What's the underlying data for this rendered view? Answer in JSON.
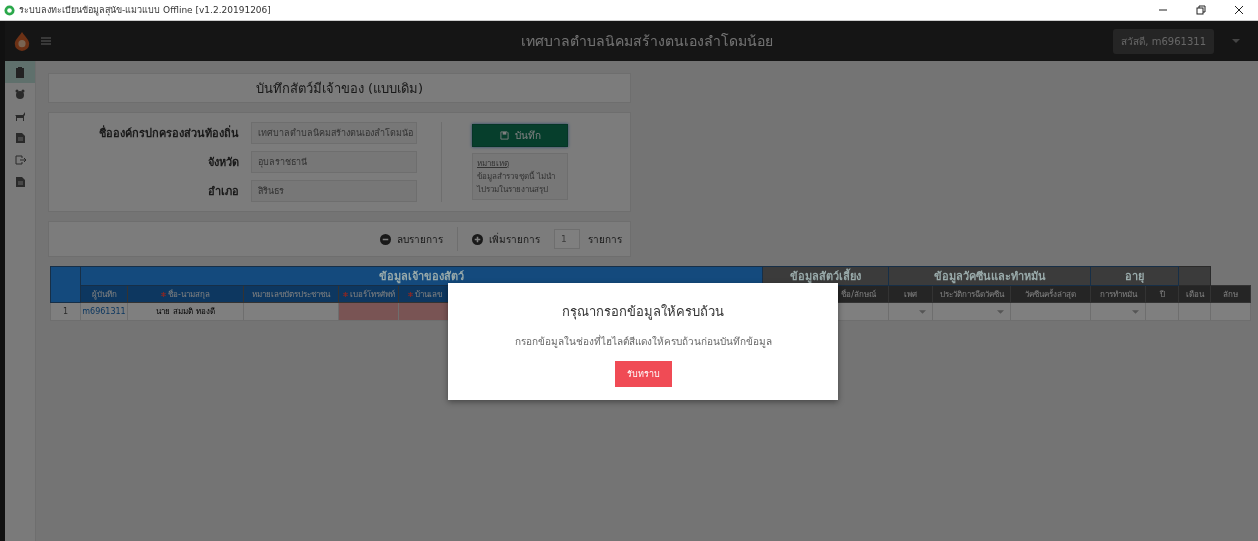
{
  "title_bar": {
    "title": "ระบบลงทะเบียนข้อมูลสุนัข-แมวแบบ Offline [v1.2.20191206]"
  },
  "header": {
    "title": "เทศบาลตำบลนิคมสร้างตนเองลำโดมน้อย",
    "user": "สวัสดี, m6961311"
  },
  "sidebar": {
    "items": [
      {
        "selected": true
      },
      {
        "selected": false
      },
      {
        "selected": false
      },
      {
        "selected": false
      },
      {
        "selected": false
      },
      {
        "selected": false
      }
    ]
  },
  "page_title": "บันทึกสัตว์มีเจ้าของ (แบบเดิม)",
  "form": {
    "fields": [
      {
        "label": "ชื่อองค์กรปกครองส่วนท้องถิ่น",
        "value": "เทศบาลตำบลนิคมสร้างตนเองลำโดมน้อ"
      },
      {
        "label": "จังหวัด",
        "value": "อุบลราชธานี"
      },
      {
        "label": "อำเภอ",
        "value": "สิรินธร"
      }
    ],
    "save_button": "บันทึก",
    "note": {
      "heading": "หมายเหตุ",
      "text": "ข้อมูลสำรวจชุดนี้ ไม่นำไปรวมในรายงานสรุป"
    }
  },
  "toolbar": {
    "remove": "ลบรายการ",
    "add": "เพิ่มรายการ",
    "count": "1",
    "unit": "รายการ"
  },
  "table": {
    "groups": [
      {
        "label": "ข้อมูลเจ้าของสัตว์",
        "color": "#144a7d"
      },
      {
        "label": "ข้อมูลสัตว์เลี้ยง",
        "color": "#3b3b3b"
      },
      {
        "label": "ข้อมูลวัคซีนและทำหมัน",
        "color": "#3b3b3b"
      },
      {
        "label": "อายุ",
        "color": "#3b3b3b"
      }
    ],
    "columns": [
      {
        "label": "ผู้บันทึก",
        "required": false
      },
      {
        "label": "ชื่อ-นามสกุล",
        "required": true
      },
      {
        "label": "หมายเลขบัตรประชาชน",
        "required": false
      },
      {
        "label": "เบอร์โทรศัพท์",
        "required": true
      },
      {
        "label": "บ้านเลข",
        "required": true
      },
      {
        "label": "ชื่อ/ลักษณ์",
        "required": false
      },
      {
        "label": "เพศ",
        "required": false
      },
      {
        "label": "ประวัติการฉีดวัคซีน",
        "required": false
      },
      {
        "label": "วัคซีนครั้งล่าสุด",
        "required": false
      },
      {
        "label": "การทำหมัน",
        "required": false
      },
      {
        "label": "ปี",
        "required": false
      },
      {
        "label": "เดือน",
        "required": false
      },
      {
        "label": "ลักษ",
        "required": false
      }
    ],
    "rows": [
      {
        "number": "1",
        "cells": [
          {
            "kind": "link",
            "value": "m6961311"
          },
          {
            "kind": "text",
            "value": "นาย สมมติ ทองดี"
          },
          {
            "kind": "text"
          },
          {
            "kind": "missing"
          },
          {
            "kind": "missing"
          },
          {
            "kind": "text"
          },
          {
            "kind": "select"
          },
          {
            "kind": "select"
          },
          {
            "kind": "text"
          },
          {
            "kind": "select"
          },
          {
            "kind": "text"
          },
          {
            "kind": "text"
          },
          {
            "kind": "text"
          }
        ]
      }
    ]
  },
  "dialog": {
    "title": "กรุณากรอกข้อมูลให้ครบถ้วน",
    "message": "กรอกข้อมูลในช่องที่ไฮไลต์สีแดงให้ครบถ้วนก่อนบันทึกข้อมูล",
    "button": "รับทราบ"
  }
}
